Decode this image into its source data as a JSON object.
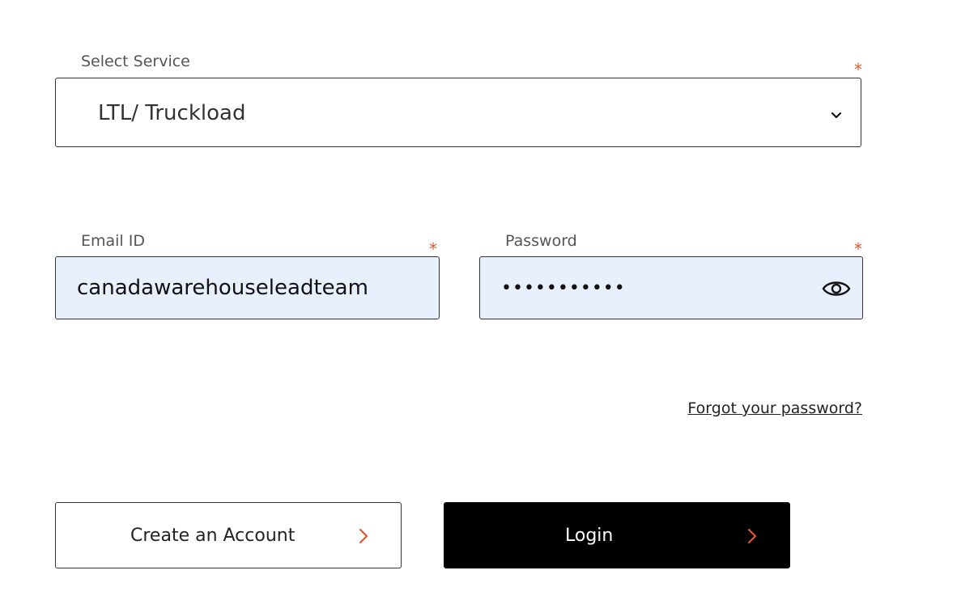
{
  "service": {
    "label": "Select Service",
    "required_mark": "*",
    "selected_value": "LTL/ Truckload",
    "icon": "chevron-down-icon"
  },
  "email": {
    "label": "Email ID",
    "required_mark": "*",
    "value": "canadawarehouseleadteam"
  },
  "password": {
    "label": "Password",
    "required_mark": "*",
    "value": "•••••••••••",
    "icon": "eye-icon"
  },
  "forgot_link": "Forgot your password?",
  "buttons": {
    "create_account": "Create an Account",
    "login": "Login",
    "arrow_icon": "chevron-right-icon"
  },
  "colors": {
    "accent": "#e4572e",
    "autofill_bg": "#e8f0fe",
    "login_bg": "#000000"
  }
}
